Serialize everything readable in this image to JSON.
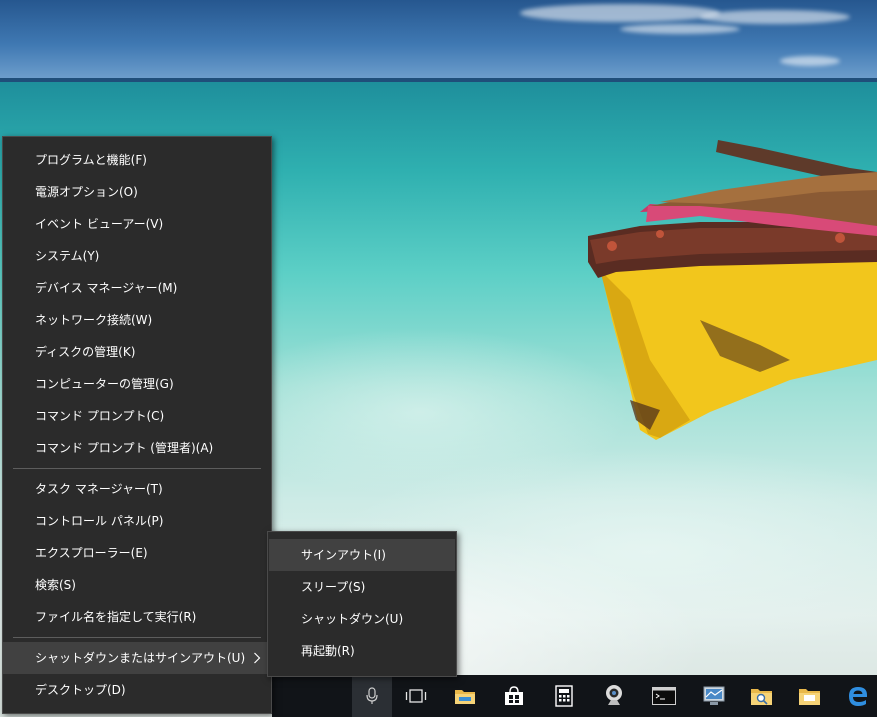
{
  "menu": {
    "group1": [
      {
        "label": "プログラムと機能(F)",
        "icon": "none"
      },
      {
        "label": "電源オプション(O)",
        "icon": "none"
      },
      {
        "label": "イベント ビューアー(V)",
        "icon": "none"
      },
      {
        "label": "システム(Y)",
        "icon": "none"
      },
      {
        "label": "デバイス マネージャー(M)",
        "icon": "none"
      },
      {
        "label": "ネットワーク接続(W)",
        "icon": "none"
      },
      {
        "label": "ディスクの管理(K)",
        "icon": "none"
      },
      {
        "label": "コンピューターの管理(G)",
        "icon": "none"
      },
      {
        "label": "コマンド プロンプト(C)",
        "icon": "none"
      },
      {
        "label": "コマンド プロンプト (管理者)(A)",
        "icon": "none"
      }
    ],
    "group2": [
      {
        "label": "タスク マネージャー(T)"
      },
      {
        "label": "コントロール パネル(P)"
      },
      {
        "label": "エクスプローラー(E)"
      },
      {
        "label": "検索(S)"
      },
      {
        "label": "ファイル名を指定して実行(R)"
      }
    ],
    "group3": [
      {
        "label": "シャットダウンまたはサインアウト(U)",
        "has_submenu": true,
        "highlighted": true
      },
      {
        "label": "デスクトップ(D)"
      }
    ]
  },
  "submenu": {
    "items": [
      {
        "label": "サインアウト(I)",
        "highlighted": true
      },
      {
        "label": "スリープ(S)"
      },
      {
        "label": "シャットダウン(U)"
      },
      {
        "label": "再起動(R)"
      }
    ]
  },
  "taskbar": {
    "icons": [
      "microphone-icon",
      "task-view-icon",
      "file-explorer-icon",
      "store-icon",
      "calculator-icon",
      "webcam-icon",
      "command-prompt-icon",
      "system-monitor-icon",
      "search-folder-icon",
      "folder-icon",
      "edge-icon"
    ]
  },
  "colors": {
    "menu_bg": "#2b2b2b",
    "menu_highlight": "#414141",
    "menu_text": "#ffffff",
    "taskbar_bg": "#111418"
  }
}
